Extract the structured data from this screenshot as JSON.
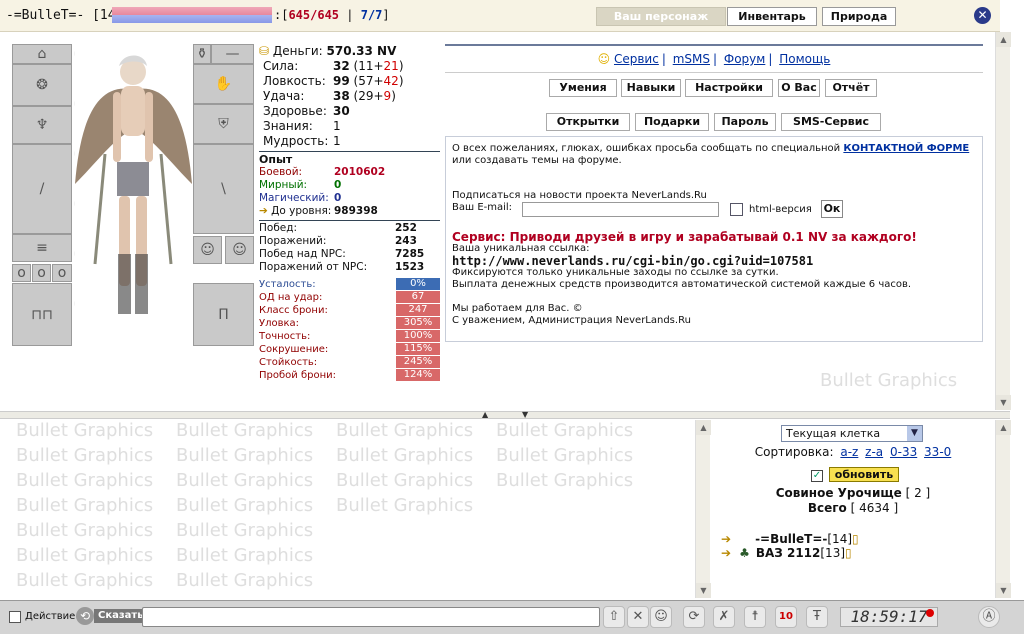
{
  "header": {
    "player_name": "-=BulleT=-",
    "level": "[14]",
    "hp": "645/645",
    "mana": "7/7",
    "buttons": {
      "character": "Ваш персонаж",
      "inventory": "Инвентарь",
      "nature": "Природа"
    },
    "close_icon": "close-icon"
  },
  "watermark": "Bullet Graphics",
  "stats": {
    "money_label": "Деньги:",
    "money": "570.33 NV",
    "strength_label": "Сила:",
    "strength": "32",
    "strength_base": "(11+",
    "strength_bonus": "21",
    "strength_close": ")",
    "agility_label": "Ловкость:",
    "agility": "99",
    "agility_base": "(57+",
    "agility_bonus": "42",
    "agility_close": ")",
    "luck_label": "Удача:",
    "luck": "38",
    "luck_base": "(29+",
    "luck_bonus": "9",
    "luck_close": ")",
    "health_label": "Здоровье:",
    "health": "30",
    "knowledge_label": "Знания:",
    "knowledge": "1",
    "wisdom_label": "Мудрость:",
    "wisdom": "1"
  },
  "experience": {
    "title": "Опыт",
    "combat_label": "Боевой:",
    "combat": "2010602",
    "peace_label": "Мирный:",
    "peace": "0",
    "magic_label": "Магический:",
    "magic": "0",
    "next_label": "До уровня:",
    "next": "989398"
  },
  "record": {
    "wins_label": "Побед:",
    "wins": "252",
    "losses_label": "Поражений:",
    "losses": "243",
    "npc_wins_label": "Побед над NPC:",
    "npc_wins": "7285",
    "npc_losses_label": "Поражений от NPC:",
    "npc_losses": "1523"
  },
  "battle_stats": [
    {
      "label": "Усталость:",
      "value": "0%"
    },
    {
      "label": "ОД на удар:",
      "value": "67"
    },
    {
      "label": "Класс брони:",
      "value": "247"
    },
    {
      "label": "Уловка:",
      "value": "305%"
    },
    {
      "label": "Точность:",
      "value": "100%"
    },
    {
      "label": "Сокрушение:",
      "value": "115%"
    },
    {
      "label": "Стойкость:",
      "value": "245%"
    },
    {
      "label": "Пробой брони:",
      "value": "124%"
    }
  ],
  "menu": {
    "links": [
      "Сервис",
      "mSMS",
      "Форум",
      "Помощь"
    ],
    "row1": [
      "Умения",
      "Навыки",
      "Настройки",
      "О Вас",
      "Отчёт"
    ],
    "row2": [
      "Открытки",
      "Подарки",
      "Пароль",
      "SMS-Сервис"
    ]
  },
  "info": {
    "line1a": "О всех пожеланиях, глюках, ошибках просьба сообщать по специальной",
    "contact_link": "КОНТАКТНОЙ ФОРМЕ",
    "line1b": "или создавать темы на форуме.",
    "subscribe": "Подписаться на новости проекта NeverLands.Ru",
    "email_label": "Ваш E-mail:",
    "html_label": "html-версия",
    "ok": "Ок",
    "promo": "Сервис: Приводи друзей в игру и зарабатывай 0.1 NV за каждого!",
    "link_label": "Ваша уникальная ссылка:",
    "link": "http://www.neverlands.ru/cgi-bin/go.cgi?uid=107581",
    "note1": "Фиксируются только уникальные заходы по ссылке за сутки.",
    "note2": "Выплата денежных средств производится автоматической системой каждые 6 часов.",
    "sign1": "Мы работаем для Вас. ©",
    "sign2": "С уважением, Администрация NeverLands.Ru"
  },
  "location": {
    "select_value": "Текущая клетка",
    "sort_label": "Сортировка:",
    "sort_options": [
      "a-z",
      "z-a",
      "0-33",
      "33-0"
    ],
    "update_button": "обновить",
    "name": "Совиное Урочище",
    "count": "[ 2 ]",
    "total_label": "Всего",
    "total": "[ 4634 ]",
    "players": [
      {
        "name": "-=BulleT=-",
        "level": "[14]"
      },
      {
        "name": "ВАЗ 2112",
        "level": "[13]"
      }
    ]
  },
  "chat": {
    "action_label": "Действие",
    "say_label": "Сказать:",
    "clock": "18:59:17"
  }
}
